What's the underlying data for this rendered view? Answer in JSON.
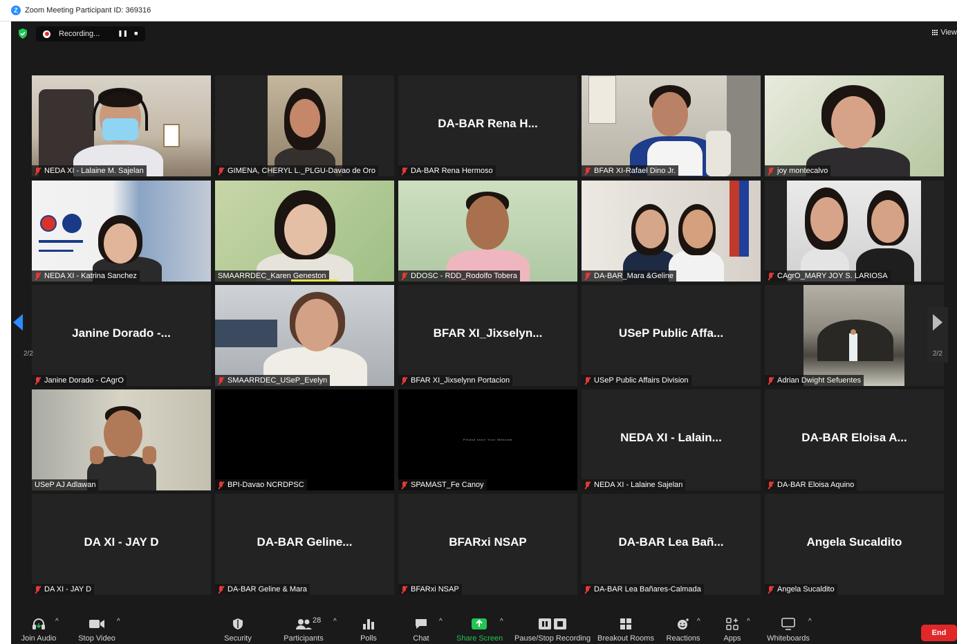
{
  "window": {
    "title": "Zoom Meeting Participant ID: 369316"
  },
  "topbar": {
    "recording_label": "Recording...",
    "pause_icon": "❚❚",
    "stop_icon": "■",
    "view_label": "View"
  },
  "tiles": [
    {
      "big": "",
      "label": "NEDA XI - Lalaine M. Sajelan",
      "muted": true
    },
    {
      "big": "",
      "label": "GIMENA, CHERYL L._PLGU-Davao de Oro",
      "muted": true
    },
    {
      "big": "DA-BAR  Rena  H...",
      "label": "DA-BAR Rena Hermoso",
      "muted": true
    },
    {
      "big": "",
      "label": "BFAR XI-Rafael Dino Jr.",
      "muted": true
    },
    {
      "big": "",
      "label": "joy montecalvo",
      "muted": true
    },
    {
      "big": "",
      "label": "NEDA XI - Katrina Sanchez",
      "muted": true
    },
    {
      "big": "",
      "label": "SMAARRDEC_Karen Geneston",
      "muted": false
    },
    {
      "big": "",
      "label": "DDOSC - RDD_Rodolfo Tobera",
      "muted": true
    },
    {
      "big": "",
      "label": "DA-BAR_Mara &Geline",
      "muted": true
    },
    {
      "big": "",
      "label": "CAgrO_MARY JOY S. LARIOSA",
      "muted": true
    },
    {
      "big": "Janine  Dorado  -...",
      "label": "Janine Dorado - CAgrO",
      "muted": true
    },
    {
      "big": "",
      "label": "SMAARRDEC_USeP_Evelyn",
      "muted": true
    },
    {
      "big": "BFAR  XI_Jixselyn...",
      "label": "BFAR XI_Jixselynn Portacion",
      "muted": true
    },
    {
      "big": "USeP  Public  Affa...",
      "label": "USeP Public Affairs Division",
      "muted": true
    },
    {
      "big": "",
      "label": "Adrian Dwight Sefuentes",
      "muted": true
    },
    {
      "big": "",
      "label": "USeP AJ Adlawan",
      "muted": false
    },
    {
      "big": "",
      "label": "BPI-Davao NCRDPSC",
      "muted": true
    },
    {
      "big": "",
      "label": "SPAMAST_Fe Canoy",
      "muted": true
    },
    {
      "big": "NEDA  XI  -  Lalain...",
      "label": "NEDA XI - Lalaine Sajelan",
      "muted": true
    },
    {
      "big": "DA-BAR  Eloisa  A...",
      "label": "DA-BAR Eloisa Aquino",
      "muted": true
    },
    {
      "big": "DA XI - JAY D",
      "label": "DA XI - JAY D",
      "muted": true
    },
    {
      "big": "DA-BAR  Geline...",
      "label": "DA-BAR Geline & Mara",
      "muted": true
    },
    {
      "big": "BFARxi  NSAP",
      "label": "BFARxi NSAP",
      "muted": true
    },
    {
      "big": "DA-BAR  Lea  Bañ...",
      "label": "DA-BAR Lea Bañares-Calmada",
      "muted": true
    },
    {
      "big": "Angela Sucaldito",
      "label": "Angela Sucaldito",
      "muted": true
    }
  ],
  "black_screen_text": "Please start Your Webcam",
  "pagination": {
    "left": "2/2",
    "right": "2/2"
  },
  "toolbar": {
    "join_audio": "Join Audio",
    "stop_video": "Stop Video",
    "security": "Security",
    "participants": "Participants",
    "participant_count": "28",
    "polls": "Polls",
    "chat": "Chat",
    "share_screen": "Share Screen",
    "pause_stop_recording": "Pause/Stop Recording",
    "breakout_rooms": "Breakout Rooms",
    "reactions": "Reactions",
    "apps": "Apps",
    "whiteboards": "Whiteboards",
    "end": "End"
  },
  "colors": {
    "accent": "#2d8cff",
    "share_green": "#23c552",
    "end_red": "#e02828",
    "muted_mic": "#e53935"
  }
}
